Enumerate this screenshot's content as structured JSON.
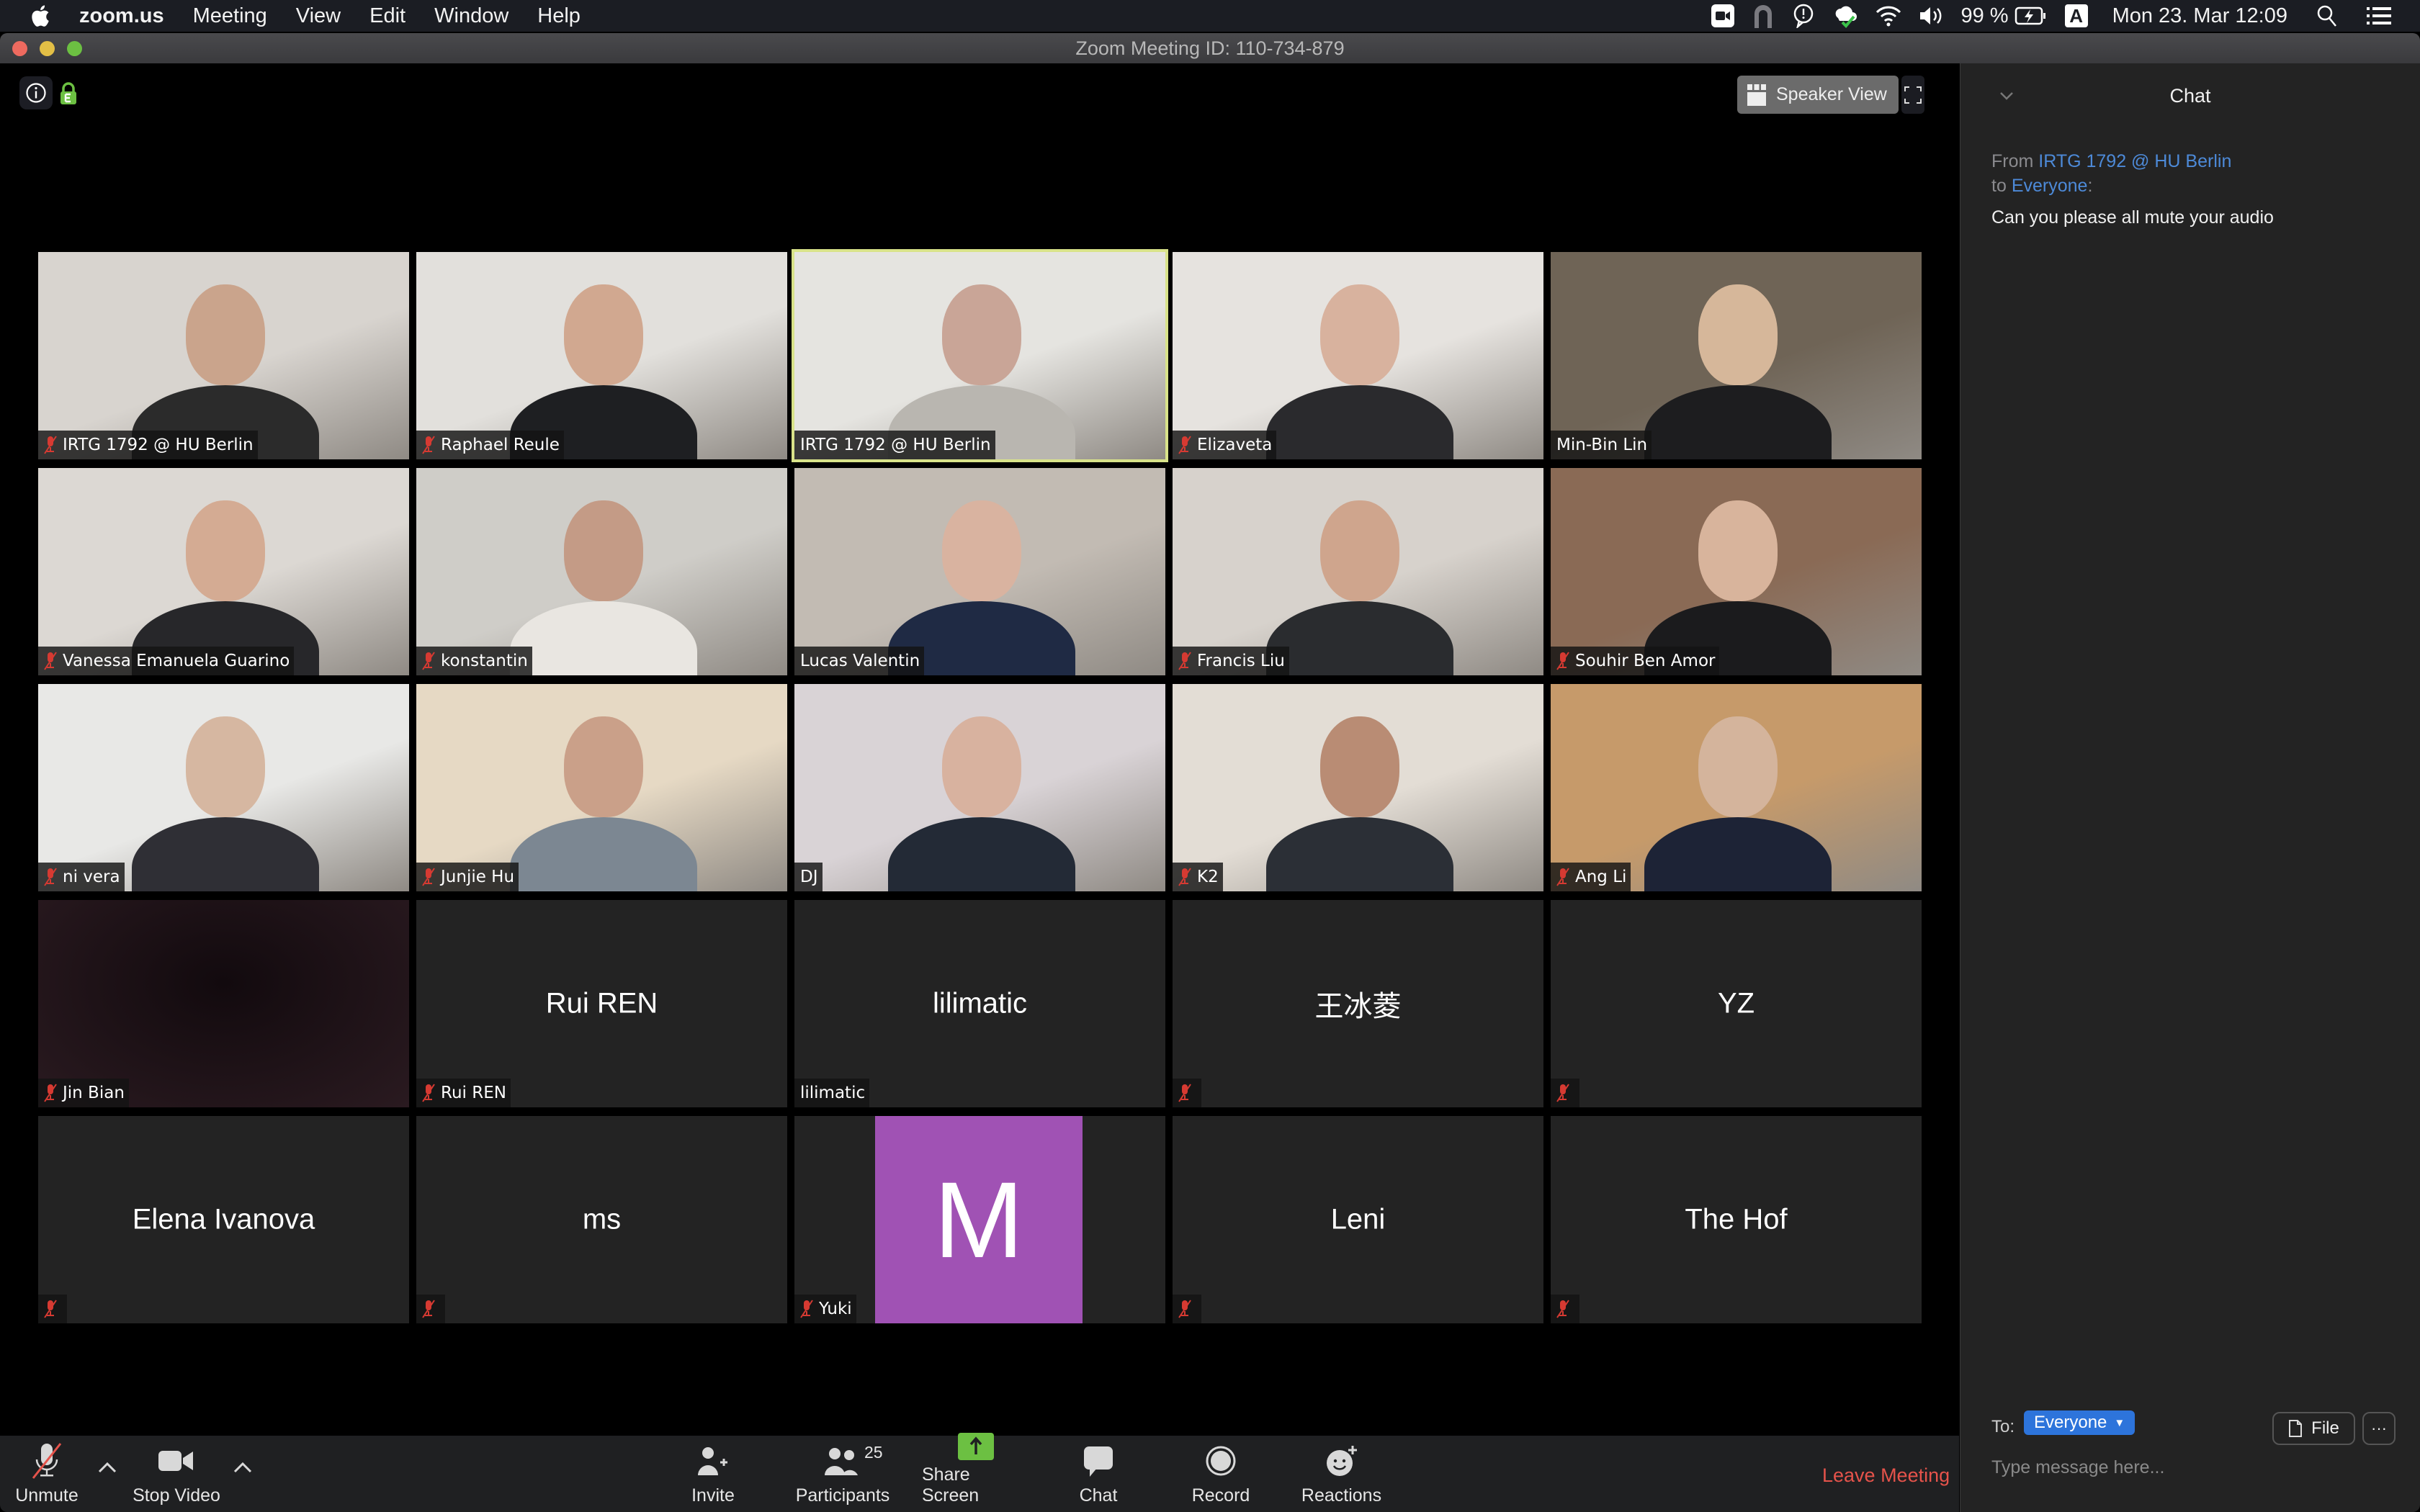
{
  "menubar": {
    "app_name": "zoom.us",
    "menus": [
      "Meeting",
      "View",
      "Edit",
      "Window",
      "Help"
    ],
    "battery": "99 %",
    "input_source": "A",
    "datetime": "Mon 23. Mar  12:09"
  },
  "window": {
    "title": "Zoom Meeting ID: 110-734-879"
  },
  "video_area": {
    "view_mode_label": "Speaker View"
  },
  "tiles": [
    {
      "name": "IRTG 1792 @ HU Berlin",
      "type": "video",
      "muted": true
    },
    {
      "name": "Raphael Reule",
      "type": "video",
      "muted": true
    },
    {
      "name": "IRTG 1792 @ HU Berlin",
      "type": "video",
      "muted": false,
      "active_speaker": true
    },
    {
      "name": "Elizaveta",
      "type": "video",
      "muted": true
    },
    {
      "name": "Min-Bin Lin",
      "type": "video",
      "muted": false
    },
    {
      "name": "Vanessa Emanuela Guarino",
      "type": "video",
      "muted": true
    },
    {
      "name": "konstantin",
      "type": "video",
      "muted": true
    },
    {
      "name": "Lucas Valentin",
      "type": "video",
      "muted": false
    },
    {
      "name": "Francis Liu",
      "type": "video",
      "muted": true
    },
    {
      "name": "Souhir Ben Amor",
      "type": "video",
      "muted": true
    },
    {
      "name": "ni vera",
      "type": "video",
      "muted": true
    },
    {
      "name": "Junjie Hu",
      "type": "video",
      "muted": true
    },
    {
      "name": "DJ",
      "type": "video",
      "muted": false
    },
    {
      "name": "K2",
      "type": "video",
      "muted": true
    },
    {
      "name": "Ang Li",
      "type": "video",
      "muted": true
    },
    {
      "name": "Jin Bian",
      "type": "dark-video",
      "muted": true
    },
    {
      "name": "Rui REN",
      "type": "name",
      "display_name": "Rui REN",
      "muted": true
    },
    {
      "name": "lilimatic",
      "type": "name",
      "display_name": "lilimatic",
      "muted": false
    },
    {
      "name": "王冰菱",
      "type": "name",
      "display_name": "王冰菱",
      "muted": true,
      "label_hidden": true
    },
    {
      "name": "YZ",
      "type": "name",
      "display_name": "YZ",
      "muted": true,
      "label_hidden": true
    },
    {
      "name": "Elena Ivanova",
      "type": "name",
      "display_name": "Elena Ivanova",
      "muted": true,
      "label_hidden": true
    },
    {
      "name": "ms",
      "type": "name",
      "display_name": "ms",
      "muted": true,
      "label_hidden": true
    },
    {
      "name": "Yuki",
      "type": "avatar",
      "avatar_letter": "M",
      "avatar_color": "#a052b4",
      "muted": true
    },
    {
      "name": "Leni",
      "type": "name",
      "display_name": "Leni",
      "muted": true,
      "label_hidden": true
    },
    {
      "name": "The Hof",
      "type": "name",
      "display_name": "The Hof",
      "muted": true,
      "label_hidden": true
    }
  ],
  "toolbar": {
    "unmute_label": "Unmute",
    "stop_video_label": "Stop Video",
    "invite_label": "Invite",
    "participants_label": "Participants",
    "participants_count": "25",
    "share_screen_label": "Share Screen",
    "chat_label": "Chat",
    "record_label": "Record",
    "reactions_label": "Reactions",
    "leave_label": "Leave Meeting"
  },
  "chat": {
    "title": "Chat",
    "messages": [
      {
        "from_prefix": "From",
        "from": "IRTG 1792 @ HU Berlin",
        "to_prefix": "to",
        "to": "Everyone",
        "text": "Can you please all mute your audio"
      }
    ],
    "to_label": "To:",
    "recipient": "Everyone",
    "file_label": "File",
    "more_label": "···",
    "input_placeholder": "Type message here..."
  },
  "colors": {
    "active_speaker_border": "#d9e38a",
    "leave_red": "#e5534b",
    "share_green": "#6cc042",
    "chat_link_blue": "#4d8ad8",
    "recipient_blue": "#2d74db",
    "muted_red": "#d63a32"
  }
}
